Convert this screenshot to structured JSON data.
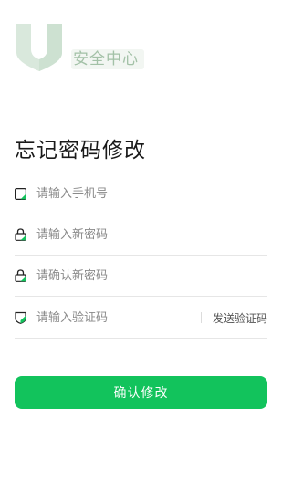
{
  "brand": {
    "logo_text": "安全中心",
    "accent": "#12c35c"
  },
  "page_title": "忘记密码修改",
  "form": {
    "phone_placeholder": "请输入手机号",
    "new_password_placeholder": "请输入新密码",
    "confirm_password_placeholder": "请确认新密码",
    "code_placeholder": "请输入验证码",
    "send_code_label": "发送验证码"
  },
  "icons": {
    "phone": "phone-icon",
    "lock": "lock-icon",
    "confirm_lock": "lock-icon",
    "shield": "shield-icon"
  },
  "confirm_label": "确认修改"
}
